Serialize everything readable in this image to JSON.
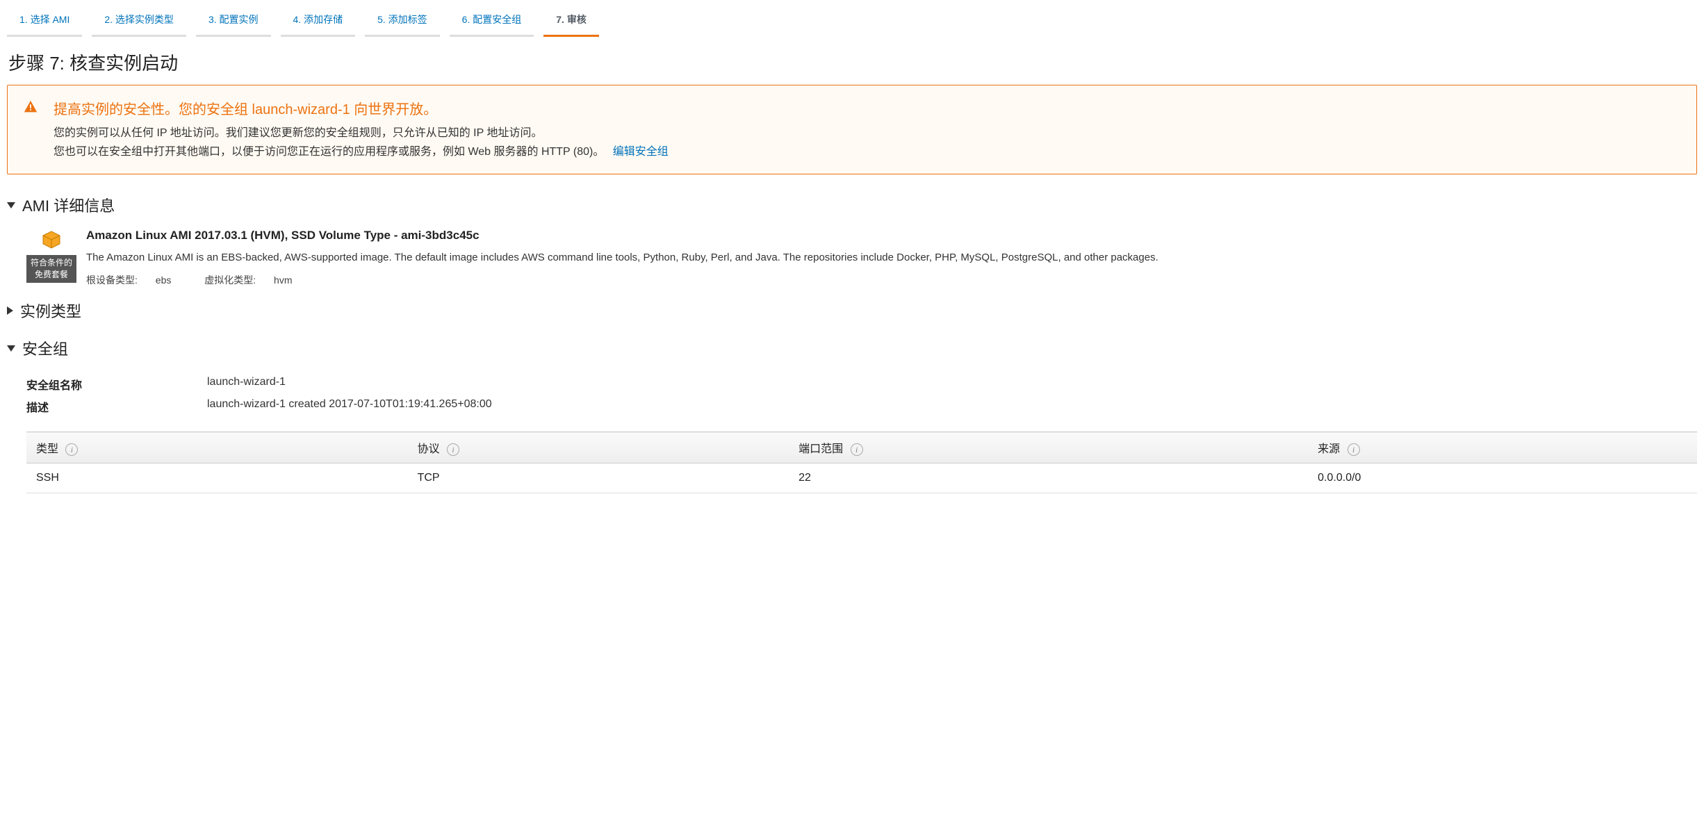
{
  "wizard_tabs": [
    {
      "label": "1. 选择 AMI",
      "active": false
    },
    {
      "label": "2. 选择实例类型",
      "active": false
    },
    {
      "label": "3. 配置实例",
      "active": false
    },
    {
      "label": "4. 添加存储",
      "active": false
    },
    {
      "label": "5. 添加标签",
      "active": false
    },
    {
      "label": "6. 配置安全组",
      "active": false
    },
    {
      "label": "7. 审核",
      "active": true
    }
  ],
  "page_title": "步骤 7: 核查实例启动",
  "alert": {
    "title": "提高实例的安全性。您的安全组 launch-wizard-1 向世界开放。",
    "line1": "您的实例可以从任何 IP 地址访问。我们建议您更新您的安全组规则，只允许从已知的 IP 地址访问。",
    "line2": "您也可以在安全组中打开其他端口，以便于访问您正在运行的应用程序或服务，例如 Web 服务器的 HTTP (80)。",
    "link_label": "编辑安全组"
  },
  "sections": {
    "ami": {
      "title": "AMI 详细信息",
      "free_tier_line1": "符合条件的",
      "free_tier_line2": "免费套餐",
      "ami_title": "Amazon Linux AMI 2017.03.1 (HVM), SSD Volume Type - ami-3bd3c45c",
      "ami_desc": "The Amazon Linux AMI is an EBS-backed, AWS-supported image. The default image includes AWS command line tools, Python, Ruby, Perl, and Java. The repositories include Docker, PHP, MySQL, PostgreSQL, and other packages.",
      "root_device_label": "根设备类型:",
      "root_device_value": "ebs",
      "virt_label": "虚拟化类型:",
      "virt_value": "hvm"
    },
    "instance_type": {
      "title": "实例类型"
    },
    "security_group": {
      "title": "安全组",
      "name_label": "安全组名称",
      "name_value": "launch-wizard-1",
      "desc_label": "描述",
      "desc_value": "launch-wizard-1 created 2017-07-10T01:19:41.265+08:00",
      "table_headers": {
        "type": "类型",
        "protocol": "协议",
        "port_range": "端口范围",
        "source": "来源"
      },
      "rules": [
        {
          "type": "SSH",
          "protocol": "TCP",
          "port_range": "22",
          "source": "0.0.0.0/0"
        }
      ]
    }
  }
}
